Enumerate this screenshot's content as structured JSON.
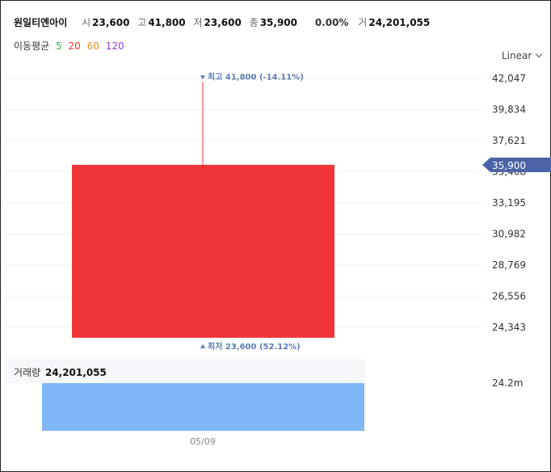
{
  "header": {
    "name": "원일티엔아이",
    "open_label": "시",
    "open": "23,600",
    "high_label": "고",
    "high": "41,800",
    "low_label": "저",
    "low": "23,600",
    "close_label": "종",
    "close": "35,900",
    "change": "0.00%",
    "volume_label": "거",
    "volume": "24,201,055"
  },
  "moving_avg": {
    "label": "이동평균",
    "periods": [
      {
        "value": "5",
        "color": "#2db24a"
      },
      {
        "value": "20",
        "color": "#e8392c"
      },
      {
        "value": "60",
        "color": "#f08a1c"
      },
      {
        "value": "120",
        "color": "#9b38d6"
      }
    ]
  },
  "scale_select": {
    "value": "Linear",
    "icon": "chevron-down-icon"
  },
  "volume_panel": {
    "label": "거래량",
    "value": "24,201,055"
  },
  "colors": {
    "up": "#f03539",
    "volume": "#80b7f7",
    "price_tag": "#4a64a7",
    "annotation": "#5b7bb5"
  },
  "chart_data": {
    "type": "candlestick",
    "x": [
      "05/09"
    ],
    "candles": [
      {
        "date": "05/09",
        "open": 23600,
        "high": 41800,
        "low": 23600,
        "close": 35900
      }
    ],
    "volume": [
      24201055
    ],
    "y_ticks": [
      "42,047",
      "39,834",
      "37,621",
      "35,408",
      "33,195",
      "30,982",
      "28,769",
      "26,556",
      "24,343"
    ],
    "y_tick_values": [
      42047,
      39834,
      37621,
      35408,
      33195,
      30982,
      28769,
      26556,
      24343
    ],
    "volume_tick": "24.2m",
    "volume_tick_value": 24200000,
    "current_price": {
      "value": 35900,
      "label": "35,900"
    },
    "annotations": {
      "high": {
        "label": "최고",
        "value": "41,800",
        "pct": "(-14.11%)"
      },
      "low": {
        "label": "최저",
        "value": "23,600",
        "pct": "(52.12%)"
      }
    },
    "scale": "linear",
    "grid": true
  }
}
